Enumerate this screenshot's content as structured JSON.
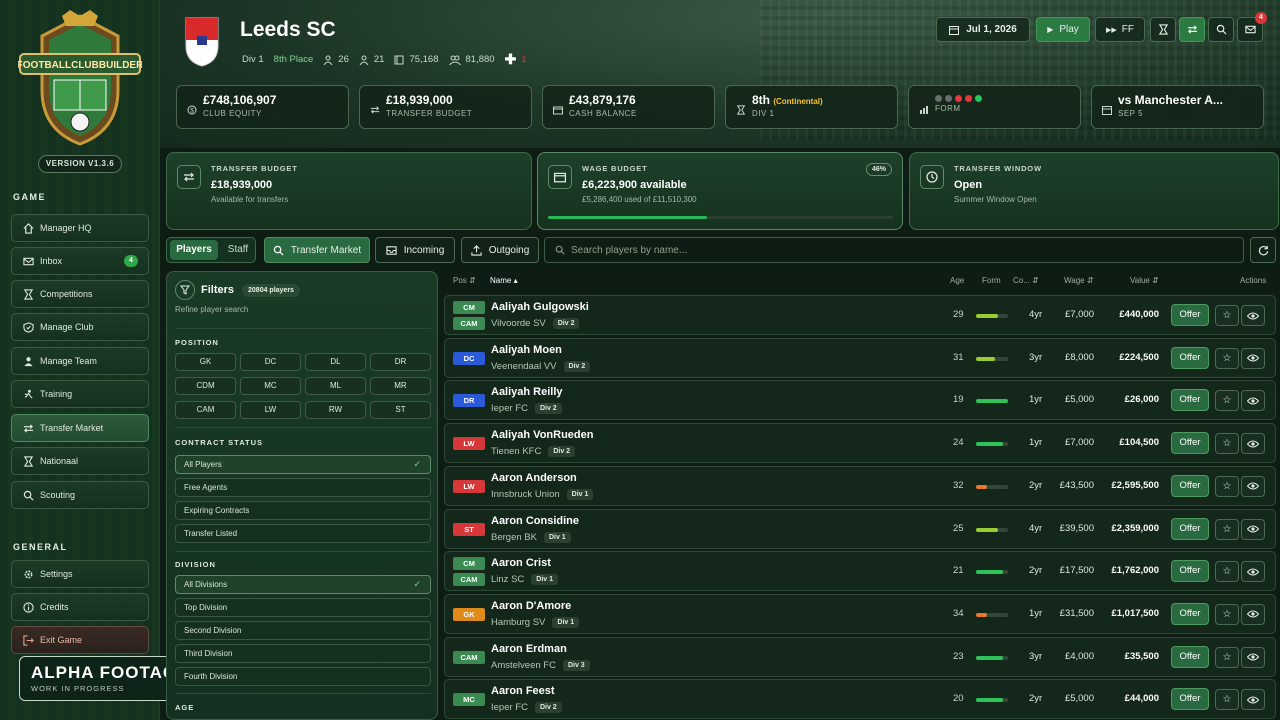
{
  "app": {
    "version": "VERSION V1.3.6",
    "logo_text": "FOOTBALLCLUBBUILDER"
  },
  "sidebar": {
    "game_title": "GAME",
    "items": [
      {
        "label": "Manager HQ",
        "icon": "home-icon"
      },
      {
        "label": "Inbox",
        "icon": "mail-icon",
        "badge": "4"
      },
      {
        "label": "Competitions",
        "icon": "trophy-icon"
      },
      {
        "label": "Manage Club",
        "icon": "shield-icon"
      },
      {
        "label": "Manage Team",
        "icon": "person-icon"
      },
      {
        "label": "Training",
        "icon": "training-icon"
      },
      {
        "label": "Transfer Market",
        "icon": "transfer-icon",
        "active": true
      },
      {
        "label": "Nationaal",
        "icon": "trophy-icon"
      },
      {
        "label": "Scouting",
        "icon": "search-icon"
      }
    ],
    "general_title": "GENERAL",
    "general_items": [
      {
        "label": "Settings",
        "icon": "gear-icon"
      },
      {
        "label": "Credits",
        "icon": "info-icon"
      },
      {
        "label": "Exit Game",
        "icon": "exit-icon"
      }
    ]
  },
  "alpha": {
    "title": "ALPHA FOOTAGE",
    "subtitle": "WORK IN PROGRESS"
  },
  "header": {
    "club_name": "Leeds SC",
    "division": "Div 1",
    "place": "8th Place",
    "squad": "26",
    "staff": "21",
    "stadium": "75,168",
    "fans": "81,880",
    "plus": "1",
    "date": "Jul 1, 2026",
    "play_label": "Play",
    "ff_label": "FF",
    "mail_badge": "4"
  },
  "stats": [
    {
      "value": "£748,106,907",
      "label": "CLUB EQUITY"
    },
    {
      "value": "£18,939,000",
      "label": "TRANSFER BUDGET"
    },
    {
      "value": "£43,879,176",
      "label": "CASH BALANCE"
    },
    {
      "value": "8th",
      "extra": "(Continental)",
      "label": "DIV 1"
    },
    {
      "label": "FORM",
      "form": [
        "#6a6e6a",
        "#6a6e6a",
        "#e23a3a",
        "#e23a3a",
        "#2ec25a"
      ]
    },
    {
      "value": "vs Manchester A...",
      "label": "SEP 5"
    }
  ],
  "cards": {
    "transfer": {
      "title": "TRANSFER BUDGET",
      "value": "£18,939,000",
      "sub": "Available for transfers"
    },
    "wage": {
      "title": "WAGE BUDGET",
      "value": "£6,223,900 available",
      "sub": "£5,286,400 used of £11,510,300",
      "pct": "46%",
      "pct_value": 0.46
    },
    "window": {
      "title": "TRANSFER WINDOW",
      "value": "Open",
      "sub": "Summer Window Open"
    }
  },
  "tabs": {
    "players": "Players",
    "staff": "Staff",
    "market": "Transfer Market",
    "incoming": "Incoming",
    "outgoing": "Outgoing"
  },
  "search": {
    "placeholder": "Search players by name..."
  },
  "filters": {
    "title": "Filters",
    "count": "20804 players",
    "subtitle": "Refine player search",
    "position_title": "POSITION",
    "positions": [
      "GK",
      "DC",
      "DL",
      "DR",
      "CDM",
      "MC",
      "ML",
      "MR",
      "CAM",
      "LW",
      "RW",
      "ST"
    ],
    "contract_title": "CONTRACT STATUS",
    "contract": [
      "All Players",
      "Free Agents",
      "Expiring Contracts",
      "Transfer Listed"
    ],
    "division_title": "DIVISION",
    "divisions": [
      "All Divisions",
      "Top Division",
      "Second Division",
      "Third Division",
      "Fourth Division"
    ],
    "age_title": "AGE"
  },
  "table": {
    "headers": {
      "pos": "Pos",
      "name": "Name",
      "age": "Age",
      "form": "Form",
      "con": "Co...",
      "wage": "Wage",
      "value": "Value",
      "actions": "Actions"
    },
    "offer_label": "Offer",
    "rows": [
      {
        "pos": [
          "CM",
          "CAM"
        ],
        "name": "Aaliyah Gulgowski",
        "club": "Vilvoorde SV",
        "div": "Div 2",
        "age": "29",
        "form": 0.7,
        "form_color": "#9acd32",
        "con": "4yr",
        "wage": "£7,000",
        "value": "£440,000"
      },
      {
        "pos": [
          "DC"
        ],
        "name": "Aaliyah Moen",
        "club": "Veenendaal VV",
        "div": "Div 2",
        "age": "31",
        "form": 0.6,
        "form_color": "#9acd32",
        "con": "3yr",
        "wage": "£8,000",
        "value": "£224,500"
      },
      {
        "pos": [
          "DR"
        ],
        "name": "Aaliyah Reilly",
        "club": "Ieper FC",
        "div": "Div 2",
        "age": "19",
        "form": 1.0,
        "form_color": "#2ec25a",
        "con": "1yr",
        "wage": "£5,000",
        "value": "£26,000"
      },
      {
        "pos": [
          "LW"
        ],
        "name": "Aaliyah VonRueden",
        "club": "Tienen KFC",
        "div": "Div 2",
        "age": "24",
        "form": 0.85,
        "form_color": "#2ec25a",
        "con": "1yr",
        "wage": "£7,000",
        "value": "£104,500"
      },
      {
        "pos": [
          "LW"
        ],
        "name": "Aaron Anderson",
        "club": "Innsbruck Union",
        "div": "Div 1",
        "age": "32",
        "form": 0.35,
        "form_color": "#e8792a",
        "con": "2yr",
        "wage": "£43,500",
        "value": "£2,595,500"
      },
      {
        "pos": [
          "ST"
        ],
        "name": "Aaron Considine",
        "club": "Bergen BK",
        "div": "Div 1",
        "age": "25",
        "form": 0.7,
        "form_color": "#9acd32",
        "con": "4yr",
        "wage": "£39,500",
        "value": "£2,359,000"
      },
      {
        "pos": [
          "CM",
          "CAM"
        ],
        "name": "Aaron Crist",
        "club": "Linz SC",
        "div": "Div 1",
        "age": "21",
        "form": 0.85,
        "form_color": "#2ec25a",
        "con": "2yr",
        "wage": "£17,500",
        "value": "£1,762,000"
      },
      {
        "pos": [
          "GK"
        ],
        "name": "Aaron D'Amore",
        "club": "Hamburg SV",
        "div": "Div 1",
        "age": "34",
        "form": 0.35,
        "form_color": "#e8792a",
        "con": "1yr",
        "wage": "£31,500",
        "value": "£1,017,500"
      },
      {
        "pos": [
          "CAM"
        ],
        "name": "Aaron Erdman",
        "club": "Amstelveen FC",
        "div": "Div 3",
        "age": "23",
        "form": 0.85,
        "form_color": "#2ec25a",
        "con": "3yr",
        "wage": "£4,000",
        "value": "£35,500"
      },
      {
        "pos": [
          "MC"
        ],
        "name": "Aaron Feest",
        "club": "Ieper FC",
        "div": "Div 2",
        "age": "20",
        "form": 0.85,
        "form_color": "#2ec25a",
        "con": "2yr",
        "wage": "£5,000",
        "value": "£44,000"
      }
    ]
  },
  "colors": {
    "accent": "#2a6a40",
    "bg": "#0e1d14",
    "badge_red": "#d8373a"
  }
}
